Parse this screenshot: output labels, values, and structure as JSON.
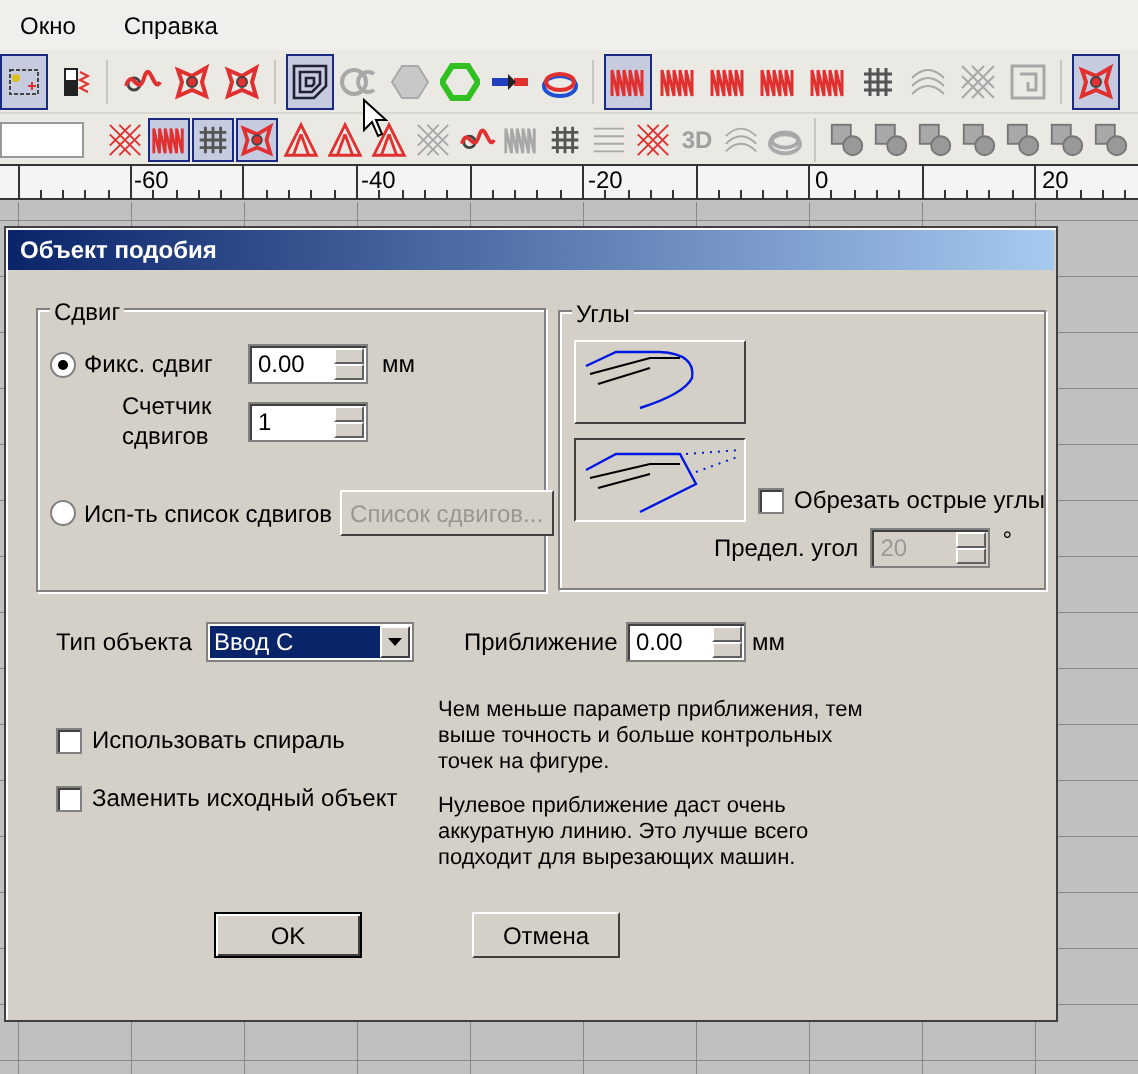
{
  "menu": [
    {
      "label": "Окно"
    },
    {
      "label": "Справка"
    }
  ],
  "toolbar_1": [
    {
      "kind": "node",
      "pressed": true,
      "disabled": false
    },
    {
      "kind": "battery",
      "pressed": false,
      "disabled": false
    },
    {
      "kind": "sep"
    },
    {
      "kind": "wave",
      "pressed": false,
      "disabled": false
    },
    {
      "kind": "star",
      "pressed": false,
      "disabled": false
    },
    {
      "kind": "star",
      "pressed": false,
      "disabled": false
    },
    {
      "kind": "sep"
    },
    {
      "kind": "nested-square",
      "pressed": true,
      "disabled": false
    },
    {
      "kind": "circles",
      "pressed": false,
      "disabled": true
    },
    {
      "kind": "hexagon",
      "pressed": false,
      "disabled": true
    },
    {
      "kind": "hexagon",
      "pressed": false,
      "disabled": false
    },
    {
      "kind": "connector",
      "pressed": false,
      "disabled": false
    },
    {
      "kind": "disc",
      "pressed": false,
      "disabled": false
    },
    {
      "kind": "sep"
    },
    {
      "kind": "zigzag",
      "pressed": true,
      "disabled": false
    },
    {
      "kind": "zigzag",
      "pressed": false,
      "disabled": false
    },
    {
      "kind": "zigzag",
      "pressed": false,
      "disabled": false
    },
    {
      "kind": "zigzag",
      "pressed": false,
      "disabled": false
    },
    {
      "kind": "zigzag",
      "pressed": false,
      "disabled": false
    },
    {
      "kind": "grid",
      "pressed": false,
      "disabled": false
    },
    {
      "kind": "arcs",
      "pressed": false,
      "disabled": true
    },
    {
      "kind": "hatch",
      "pressed": false,
      "disabled": true
    },
    {
      "kind": "maze",
      "pressed": false,
      "disabled": true
    },
    {
      "kind": "sep"
    },
    {
      "kind": "star",
      "pressed": true,
      "disabled": false
    }
  ],
  "toolbar_2": [
    {
      "kind": "hatch",
      "pressed": false,
      "disabled": false
    },
    {
      "kind": "zigzag",
      "pressed": true,
      "disabled": false
    },
    {
      "kind": "grid",
      "pressed": true,
      "disabled": false
    },
    {
      "kind": "star",
      "pressed": true,
      "disabled": false
    },
    {
      "kind": "triangle",
      "pressed": false,
      "disabled": false
    },
    {
      "kind": "triangle",
      "pressed": false,
      "disabled": false
    },
    {
      "kind": "triangle",
      "pressed": false,
      "disabled": false
    },
    {
      "kind": "hatch",
      "pressed": false,
      "disabled": true
    },
    {
      "kind": "wave",
      "pressed": false,
      "disabled": false
    },
    {
      "kind": "zigzag",
      "pressed": false,
      "disabled": true
    },
    {
      "kind": "grid",
      "pressed": false,
      "disabled": false
    },
    {
      "kind": "lines",
      "pressed": false,
      "disabled": true
    },
    {
      "kind": "hatch",
      "pressed": false,
      "disabled": false
    },
    {
      "kind": "text",
      "label": "3D",
      "pressed": false,
      "disabled": true
    },
    {
      "kind": "arcs",
      "pressed": false,
      "disabled": true
    },
    {
      "kind": "disc",
      "pressed": false,
      "disabled": true
    },
    {
      "kind": "sep"
    },
    {
      "kind": "combine",
      "pressed": false,
      "disabled": true
    },
    {
      "kind": "combine",
      "pressed": false,
      "disabled": true
    },
    {
      "kind": "combine",
      "pressed": false,
      "disabled": true
    },
    {
      "kind": "combine",
      "pressed": false,
      "disabled": true
    },
    {
      "kind": "combine",
      "pressed": false,
      "disabled": true
    },
    {
      "kind": "combine",
      "pressed": false,
      "disabled": true
    },
    {
      "kind": "combine",
      "pressed": false,
      "disabled": true
    }
  ],
  "ruler": {
    "labels": [
      "-60",
      "-40",
      "-20",
      "0",
      "20"
    ]
  },
  "dialog": {
    "title": "Объект подобия",
    "offset_group": {
      "title": "Сдвиг",
      "options": [
        {
          "label": "Фикс. сдвиг",
          "selected": true
        },
        {
          "label": "Исп-ть список сдвигов",
          "selected": false
        }
      ],
      "offset": {
        "value": "0.00",
        "unit": "мм"
      },
      "count": {
        "label": "Счетчик сдвигов",
        "value": "1"
      },
      "list_button": {
        "label": "Список сдвигов...",
        "disabled": true
      }
    },
    "corners_group": {
      "title": "Углы",
      "styles": [
        {
          "kind": "round",
          "selected": false
        },
        {
          "kind": "sharp",
          "selected": true
        }
      ],
      "cut_sharp": {
        "label": "Обрезать острые углы",
        "checked": false
      },
      "limit": {
        "label": "Предел. угол",
        "value": "20",
        "unit": "°",
        "disabled": true
      }
    },
    "object_type": {
      "label": "Тип объекта",
      "value": "Ввод С"
    },
    "approximation": {
      "label": "Приближение",
      "value": "0.00",
      "unit": "мм"
    },
    "options": [
      {
        "label": "Использовать спираль",
        "checked": false
      },
      {
        "label": "Заменить исходный объект",
        "checked": false
      }
    ],
    "notes": [
      "Чем меньше параметр приближения, тем  выше точность и больше контрольных точек на фигуре.",
      "Нулевое приближение даст очень аккуратную линию. Это лучше всего подходит для вырезающих машин."
    ],
    "buttons": [
      {
        "label": "OK",
        "default": true
      },
      {
        "label": "Отмена",
        "default": false
      }
    ]
  }
}
